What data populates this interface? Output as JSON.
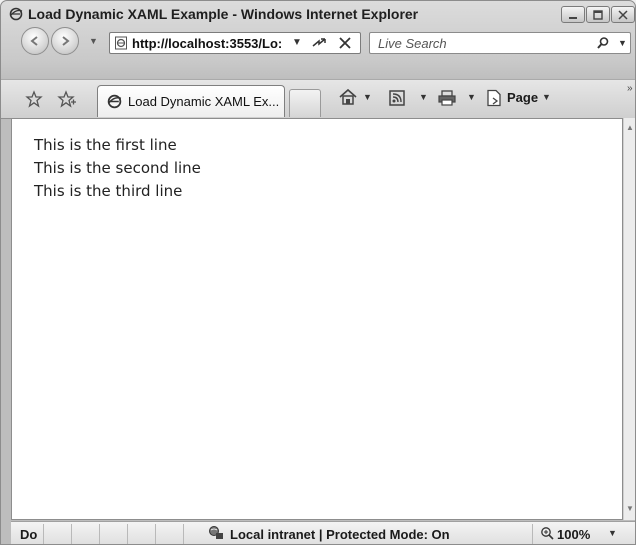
{
  "window": {
    "title": "Load Dynamic XAML Example - Windows Internet Explorer"
  },
  "address_bar": {
    "url": "http://localhost:3553/Lo:"
  },
  "search": {
    "placeholder": "Live Search"
  },
  "tab": {
    "label": "Load Dynamic XAML Ex..."
  },
  "toolbar": {
    "page_label": "Page"
  },
  "content": {
    "lines": [
      "This is the first line",
      "This is the second line",
      "This is the third line"
    ]
  },
  "status_bar": {
    "left_text": "Do",
    "zone_text": "Local intranet | Protected Mode: On",
    "zoom_text": "100%"
  },
  "icons": {
    "browser": "ie-icon",
    "back": "back-icon",
    "forward": "forward-icon",
    "refresh": "refresh-icon",
    "stop": "stop-icon",
    "search": "search-icon",
    "favorites": "favorites-icon",
    "add_favorites": "add-favorites-icon",
    "home": "home-icon",
    "feeds": "feeds-icon",
    "print": "print-icon",
    "page": "page-icon",
    "zone": "local-intranet-icon",
    "zoom": "zoom-icon"
  },
  "colors": {
    "chrome": "#cfcfcf",
    "content_background": "#ffffff",
    "text": "#222222"
  }
}
